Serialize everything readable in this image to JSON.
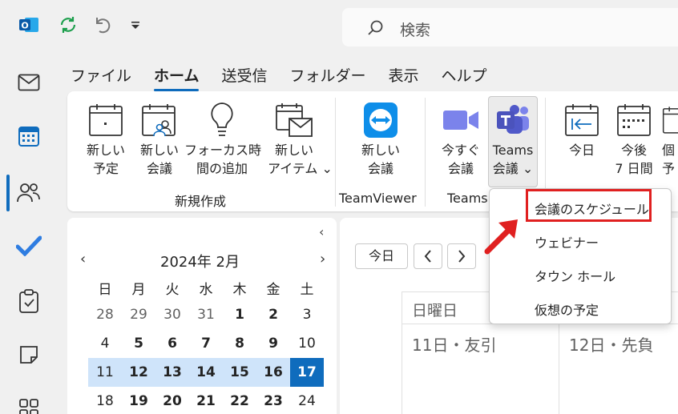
{
  "search": {
    "placeholder": "検索"
  },
  "tabs": [
    {
      "label": "ファイル"
    },
    {
      "label": "ホーム"
    },
    {
      "label": "送受信"
    },
    {
      "label": "フォルダー"
    },
    {
      "label": "表示"
    },
    {
      "label": "ヘルプ"
    }
  ],
  "ribbon": {
    "new_mail": "新しい\n予定",
    "new_meeting": "新しい\n会議",
    "focus_time": "フォーカス時\n間の追加",
    "new_items": "新しい\nアイテム ⌄",
    "group_new": "新規作成",
    "tv_new_meeting": "新しい\n会議",
    "group_tv": "TeamViewer",
    "meet_now": "今すぐ\n会議",
    "teams_meeting": "Teams\n会議 ⌄",
    "group_teams": "Teams",
    "today": "今日",
    "next7": "今後\n7 日間",
    "personal": "個\n予"
  },
  "mini_calendar": {
    "title": "2024年 2月",
    "dow": [
      "日",
      "月",
      "火",
      "水",
      "木",
      "金",
      "土"
    ],
    "weeks": [
      [
        "28",
        "29",
        "30",
        "31",
        "1",
        "2",
        "3"
      ],
      [
        "4",
        "5",
        "6",
        "7",
        "8",
        "9",
        "10"
      ],
      [
        "11",
        "12",
        "13",
        "14",
        "15",
        "16",
        "17"
      ],
      [
        "18",
        "19",
        "20",
        "21",
        "22",
        "23",
        "24"
      ]
    ]
  },
  "main": {
    "today_button": "今日",
    "day_header": "日曜日",
    "date1": "11日・友引",
    "date2": "12日・先負"
  },
  "dropdown": {
    "items": [
      "会議のスケジュール",
      "ウェビナー",
      "タウン ホール",
      "仮想の予定"
    ]
  },
  "colors": {
    "accent": "#0f6cbd",
    "highlight": "#e02020"
  }
}
